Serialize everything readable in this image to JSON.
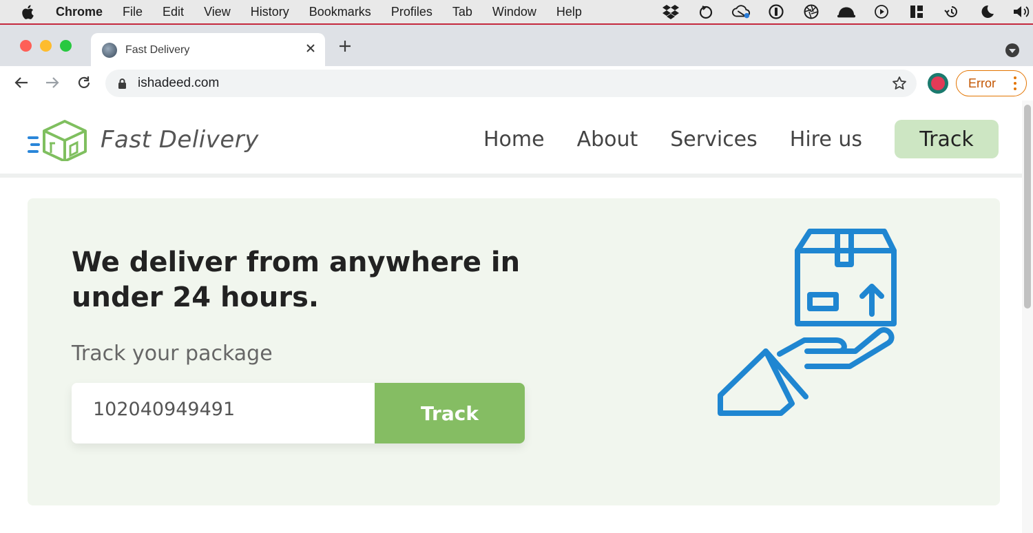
{
  "menubar": {
    "app": "Chrome",
    "items": [
      "File",
      "Edit",
      "View",
      "History",
      "Bookmarks",
      "Profiles",
      "Tab",
      "Window",
      "Help"
    ],
    "status_icons": [
      "dropbox-icon",
      "loop-icon",
      "cloud-sync-icon",
      "onepassword-icon",
      "aperture-icon",
      "hat-icon",
      "play-icon",
      "grid-icon",
      "time-machine-icon",
      "moon-icon",
      "volume-icon"
    ]
  },
  "browser": {
    "tab_title": "Fast Delivery",
    "url": "ishadeed.com",
    "error_label": "Error"
  },
  "site": {
    "brand": "Fast Delivery",
    "nav": [
      "Home",
      "About",
      "Services",
      "Hire us"
    ],
    "nav_cta": "Track",
    "hero_title": "We deliver from anywhere in under 24 hours.",
    "hero_subtitle": "Track your package",
    "tracking_value": "102040949491",
    "track_button": "Track"
  },
  "colors": {
    "accent_green": "#85bd63",
    "light_green": "#cde6c3",
    "hero_bg": "#f1f6ee",
    "icon_blue": "#1f86d1",
    "logo_green": "#7fbf5f"
  }
}
